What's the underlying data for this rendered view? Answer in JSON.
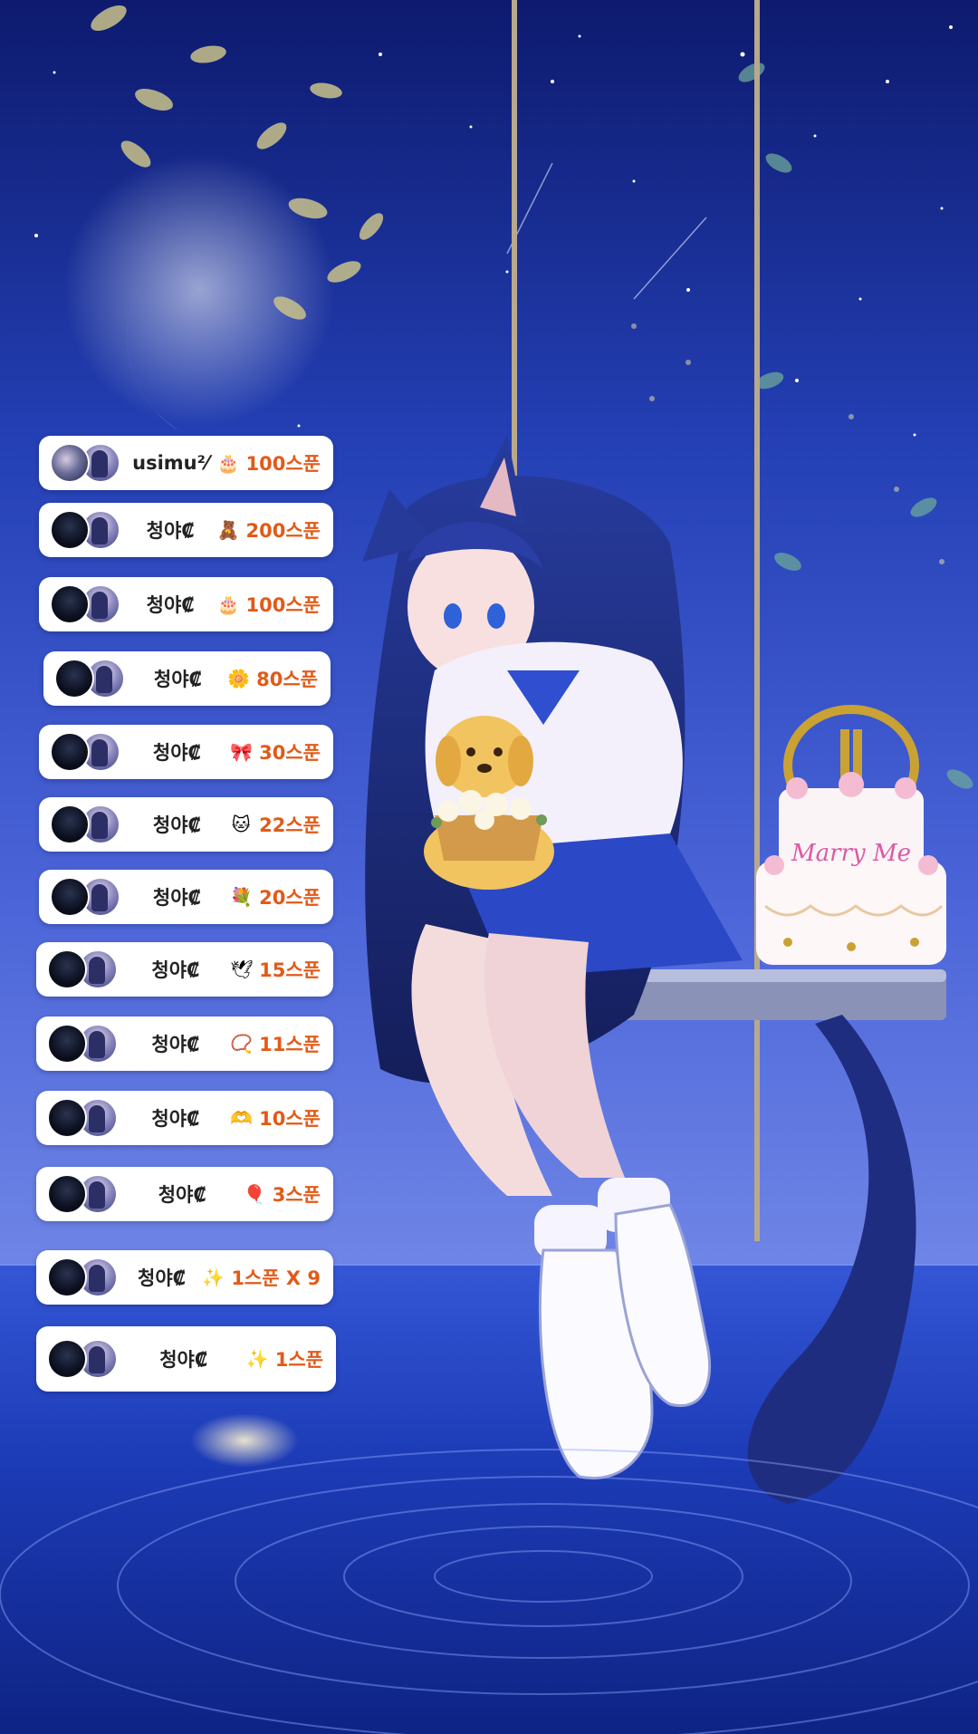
{
  "donations": [
    {
      "name": "usimu²⁄",
      "gift_icon": "cake-icon",
      "amount": "100스푼"
    },
    {
      "name": "청야₡",
      "gift_icon": "bear-icon",
      "amount": "200스푼"
    },
    {
      "name": "청야₡",
      "gift_icon": "cake-icon",
      "amount": "100스푼"
    },
    {
      "name": "청야₡",
      "gift_icon": "flower-icon",
      "amount": "80스푼"
    },
    {
      "name": "청야₡",
      "gift_icon": "ribbon-icon",
      "amount": "30스푼"
    },
    {
      "name": "청야₡",
      "gift_icon": "cat-icon",
      "amount": "22스푼"
    },
    {
      "name": "청야₡",
      "gift_icon": "bouquet-icon",
      "amount": "20스푼"
    },
    {
      "name": "청야₡",
      "gift_icon": "dove-icon",
      "amount": "15스푼"
    },
    {
      "name": "청야₡",
      "gift_icon": "necklace-icon",
      "amount": "11스푼"
    },
    {
      "name": "청야₡",
      "gift_icon": "heart-hands-icon",
      "amount": "10스푼"
    },
    {
      "name": "청야₡",
      "gift_icon": "balloon-icon",
      "amount": "3스푼"
    },
    {
      "name": "청야₡",
      "gift_icon": "sparkle-wand-icon",
      "amount": "1스푼 X 9"
    },
    {
      "name": "청야₡",
      "gift_icon": "sparkle-wand-icon",
      "amount": "1스푼"
    }
  ],
  "stickers": {
    "cake_text": "Marry Me"
  },
  "colors": {
    "amount": "#e25a18",
    "name": "#222222",
    "row_bg": "#ffffff",
    "sky_top": "#0d1a6e",
    "sea": "#1c3fbf"
  }
}
